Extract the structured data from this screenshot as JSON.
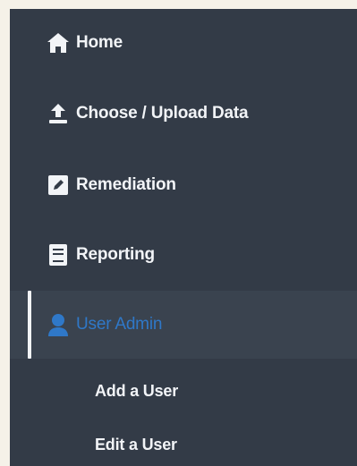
{
  "sidebar": {
    "items": [
      {
        "label": "Home",
        "icon": "home-icon"
      },
      {
        "label": "Choose / Upload Data",
        "icon": "upload-icon"
      },
      {
        "label": "Remediation",
        "icon": "edit-icon"
      },
      {
        "label": "Reporting",
        "icon": "book-icon"
      },
      {
        "label": "User Admin",
        "icon": "user-icon",
        "active": true
      }
    ],
    "subitems": [
      {
        "label": "Add a User"
      },
      {
        "label": "Edit a User"
      }
    ]
  },
  "colors": {
    "background": "#f5f1e8",
    "sidebar_bg": "#333b47",
    "active_bg": "#3a434f",
    "text": "#f2f4f7",
    "accent": "#2f78c8"
  }
}
